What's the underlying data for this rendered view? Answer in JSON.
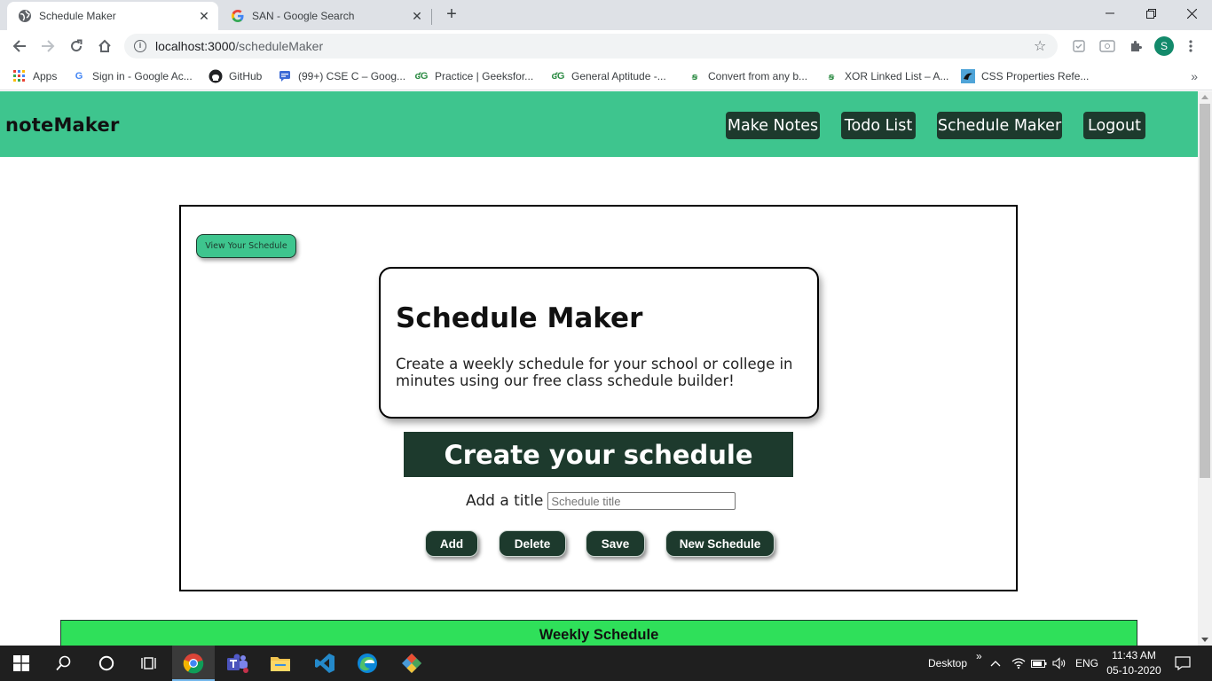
{
  "browser": {
    "tabs": [
      {
        "title": "Schedule Maker",
        "active": true
      },
      {
        "title": "SAN - Google Search",
        "active": false
      }
    ],
    "close_glyph": "✕",
    "new_tab_glyph": "+",
    "url_host": "localhost:3000",
    "url_path": "/scheduleMaker",
    "profile_initial": "S",
    "bookmarks": [
      {
        "label": "Apps",
        "icon": "apps-grid-icon"
      },
      {
        "label": "Sign in - Google Ac...",
        "icon": "google-icon"
      },
      {
        "label": "GitHub",
        "icon": "github-icon"
      },
      {
        "label": "(99+) CSE C – Goog...",
        "icon": "chat-icon"
      },
      {
        "label": "Practice | Geeksfor...",
        "icon": "geeksforgeeks-icon"
      },
      {
        "label": "General Aptitude -...",
        "icon": "geeksforgeeks-icon"
      },
      {
        "label": "Convert from any b...",
        "icon": "geeksforgeeks-icon"
      },
      {
        "label": "XOR Linked List – A...",
        "icon": "geeksforgeeks-icon"
      },
      {
        "label": "CSS Properties Refe...",
        "icon": "css-reference-icon"
      }
    ],
    "bookmarks_overflow": "»"
  },
  "app": {
    "brand": "noteMaker",
    "nav": [
      "Make Notes",
      "Todo List",
      "Schedule Maker",
      "Logout"
    ],
    "view_schedule_button": "View Your Schedule",
    "intro_title": "Schedule Maker",
    "intro_text": "Create a weekly schedule for your school or college in minutes using our free class schedule builder!",
    "create_heading": "Create your schedule",
    "title_label": "Add a title",
    "title_placeholder": "Schedule title",
    "title_value": "",
    "buttons": {
      "add": "Add",
      "delete": "Delete",
      "save": "Save",
      "new": "New Schedule"
    },
    "weekly_heading": "Weekly Schedule"
  },
  "taskbar": {
    "desktop_label": "Desktop",
    "desktop_more": "»",
    "language": "ENG",
    "time": "11:43 AM",
    "date": "05-10-2020"
  },
  "colors": {
    "accent_green": "#3ec58e",
    "dark_green": "#1d3a2d",
    "weekly_green": "#2fe05a"
  }
}
